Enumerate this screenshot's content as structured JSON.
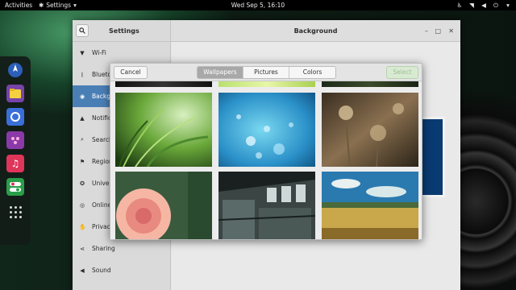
{
  "topbar": {
    "activities": "Activities",
    "app_menu": "Settings",
    "clock": "Wed Sep 5, 16:10"
  },
  "dock": {
    "apps": [
      {
        "name": "Web",
        "icon": "globe-icon",
        "color": "#2c5fb8"
      },
      {
        "name": "Files",
        "icon": "folder-icon",
        "color": "#7744aa"
      },
      {
        "name": "Software",
        "icon": "software-icon",
        "color": "#3a6fd8"
      },
      {
        "name": "Tweaks",
        "icon": "tweaks-icon",
        "color": "#8a3aa8"
      },
      {
        "name": "Music",
        "icon": "music-icon",
        "color": "#e0355a"
      },
      {
        "name": "Settings",
        "icon": "toggle-icon",
        "color": "#2a9e4a"
      }
    ]
  },
  "settings": {
    "title": "Settings",
    "panel_title": "Background",
    "sidebar": [
      {
        "label": "Wi-Fi",
        "icon": "wifi-icon"
      },
      {
        "label": "Bluetooth",
        "icon": "bluetooth-icon"
      },
      {
        "label": "Background",
        "icon": "background-icon",
        "selected": true
      },
      {
        "label": "Notifications",
        "icon": "bell-icon"
      },
      {
        "label": "Search",
        "icon": "search-icon"
      },
      {
        "label": "Region & Language",
        "icon": "region-icon"
      },
      {
        "label": "Universal Access",
        "icon": "accessibility-icon"
      },
      {
        "label": "Online Accounts",
        "icon": "accounts-icon"
      },
      {
        "label": "Privacy",
        "icon": "privacy-icon"
      },
      {
        "label": "Sharing",
        "icon": "sharing-icon"
      },
      {
        "label": "Sound",
        "icon": "sound-icon"
      }
    ]
  },
  "dialog": {
    "cancel": "Cancel",
    "select": "Select",
    "tabs": [
      "Wallpapers",
      "Pictures",
      "Colors"
    ],
    "active_tab": "Wallpapers",
    "wallpapers": [
      {
        "name": "green-grass",
        "colors": [
          "#d8f0c0",
          "#4d8a2e",
          "#1c3a12"
        ]
      },
      {
        "name": "blue-bokeh",
        "colors": [
          "#e0f6ff",
          "#3ab0d8",
          "#0d4a78"
        ]
      },
      {
        "name": "dried-flowers",
        "colors": [
          "#d8c29a",
          "#6e5a3e",
          "#2c2418"
        ]
      },
      {
        "name": "pink-flower",
        "colors": [
          "#f6b6a4",
          "#d86a6a",
          "#3a5a3e"
        ]
      },
      {
        "name": "abandoned-building",
        "colors": [
          "#cfd8d8",
          "#5a6a68",
          "#182020"
        ]
      },
      {
        "name": "wheat-field",
        "colors": [
          "#2a7ab0",
          "#c8a84a",
          "#6a4a18"
        ]
      }
    ]
  }
}
